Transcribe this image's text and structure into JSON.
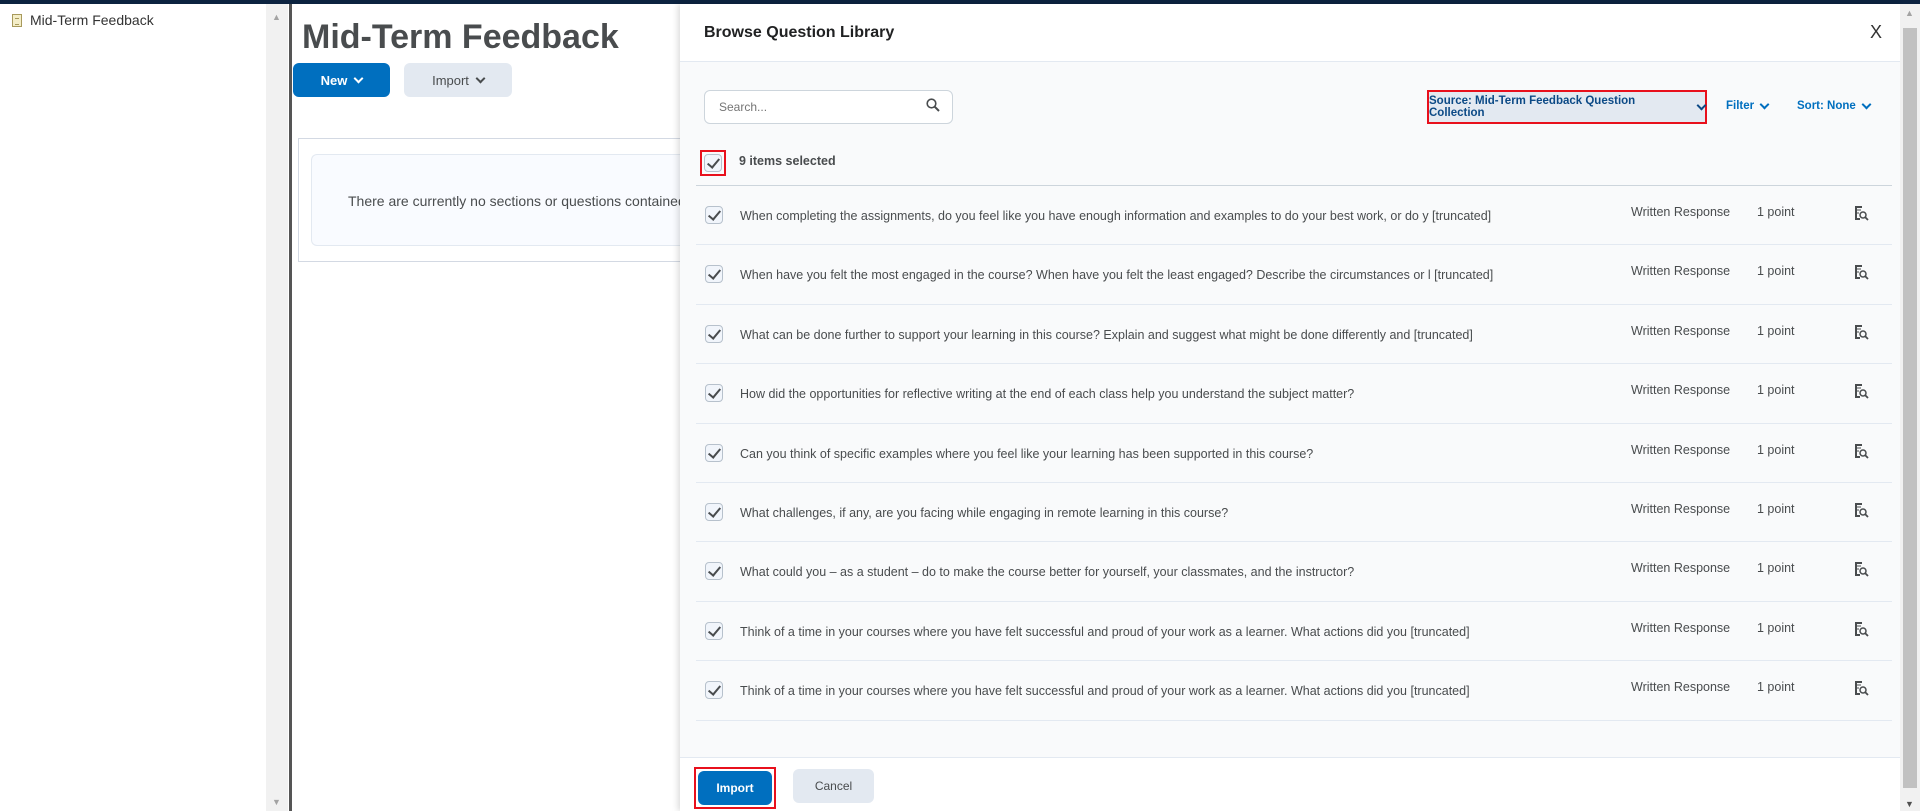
{
  "sidebar": {
    "items": [
      {
        "label": "Mid-Term Feedback",
        "icon": "document-icon"
      }
    ]
  },
  "main": {
    "title": "Mid-Term Feedback",
    "new_label": "New",
    "import_label": "Import",
    "empty_message": "There are currently no sections or questions contained i"
  },
  "dialog": {
    "title": "Browse Question Library",
    "close_label": "X",
    "search": {
      "placeholder": "Search...",
      "value": ""
    },
    "source_label": "Source: Mid-Term Feedback Question Collection",
    "filter_label": "Filter",
    "sort_label": "Sort: None",
    "selected_count": "9 items selected",
    "questions": [
      {
        "text": "When completing the assignments, do you feel like you have enough information and examples to do your best work, or do y [truncated]",
        "type": "Written Response",
        "points": "1 point",
        "checked": true
      },
      {
        "text": "When have you felt the most engaged in the course? When have you felt the least engaged? Describe the circumstances or l [truncated]",
        "type": "Written Response",
        "points": "1 point",
        "checked": true
      },
      {
        "text": "What can be done further to support your learning in this course? Explain and suggest what might be done differently and [truncated]",
        "type": "Written Response",
        "points": "1 point",
        "checked": true
      },
      {
        "text": "How did the opportunities for reflective writing at the end of each class help you understand the subject matter?",
        "type": "Written Response",
        "points": "1 point",
        "checked": true
      },
      {
        "text": "Can you think of specific examples where you feel like your learning has been supported in this course?",
        "type": "Written Response",
        "points": "1 point",
        "checked": true
      },
      {
        "text": "What challenges, if any, are you facing while engaging in remote learning in this course?",
        "type": "Written Response",
        "points": "1 point",
        "checked": true
      },
      {
        "text": "What could you – as a student – do to make the course better for yourself, your classmates, and the instructor?",
        "type": "Written Response",
        "points": "1 point",
        "checked": true
      },
      {
        "text": "Think of a time in your courses where you have felt successful and proud of your work as a learner. What actions did you [truncated]",
        "type": "Written Response",
        "points": "1 point",
        "checked": true
      },
      {
        "text": "Think of a time in your courses where you have felt successful and proud of your work as a learner. What actions did you [truncated]",
        "type": "Written Response",
        "points": "1 point",
        "checked": true
      }
    ],
    "import_label": "Import",
    "cancel_label": "Cancel"
  },
  "colors": {
    "primary": "#006fbf",
    "highlight": "#e8101c",
    "topbar": "#0c2340"
  }
}
